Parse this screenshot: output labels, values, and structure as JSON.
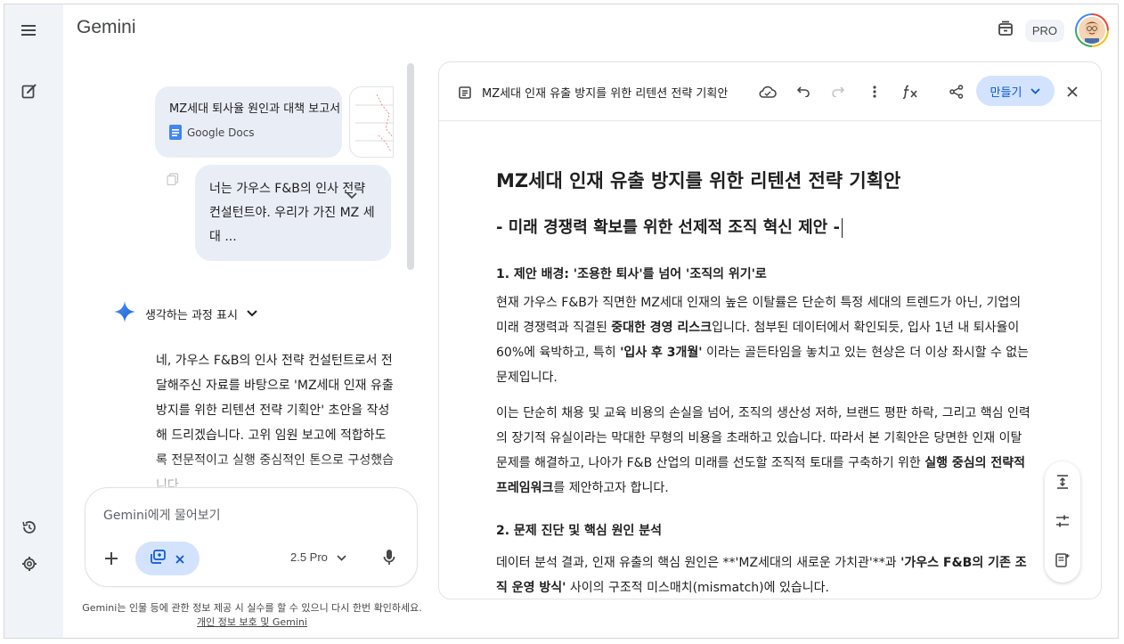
{
  "app": {
    "brand": "Gemini",
    "plan_badge": "PRO"
  },
  "chat": {
    "attachment": {
      "title": "MZ세대 퇴사율 원인과 대책 보고서",
      "source": "Google Docs"
    },
    "user_message": "너는 가우스 F&B의 인사 전략 컨설턴트야. 우리가 가진 MZ 세대 ...",
    "thinking_label": "생각하는 과정 표시",
    "answer": "네, 가우스 F&B의 인사 전략 컨설턴트로서 전달해주신 자료를 바탕으로 'MZ세대 인재 유출 방지를 위한 리텐션 전략 기획안' 초안을 작성해 드리겠습니다. 고위 임원 보고에 적합하도록 전문적이고 실행 중심적인 톤으로 구성했습니다."
  },
  "input": {
    "placeholder": "Gemini에게 물어보기",
    "model": "2.5 Pro"
  },
  "disclaimer": {
    "text": "Gemini는 인물 등에 관한 정보 제공 시 실수를 할 수 있으니 다시 한번 확인하세요.",
    "link": "개인 정보 보호 및 Gemini"
  },
  "doc": {
    "toolbar_title": "MZ세대 인재 유출 방지를 위한 리텐션 전략 기획안",
    "make_label": "만들기",
    "h1": "MZ세대 인재 유출 방지를 위한 리텐션 전략 기획안",
    "h2": "- 미래 경쟁력 확보를 위한 선제적 조직 혁신 제안 -",
    "s1_title": "1. 제안 배경: '조용한 퇴사'를 넘어 '조직의 위기'로",
    "p1": {
      "a": "현재 가우스 F&B가 직면한 MZ세대 인재의 높은 이탈률은 단순히 특정 세대의 트렌드가 아닌, 기업의 미래 경쟁력과 직결된 ",
      "b": "중대한 경영 리스크",
      "c": "입니다. 첨부된 데이터에서 확인되듯, 입사 1년 내 퇴사율이 60%에 육박하고, 특히 ",
      "d": "'입사 후 3개월'",
      "e": " 이라는 골든타임을 놓치고 있는 현상은 더 이상 좌시할 수 없는 문제입니다."
    },
    "p2": {
      "a": "이는 단순히 채용 및 교육 비용의 손실을 넘어, 조직의 생산성 저하, 브랜드 평판 하락, 그리고 핵심 인력의 장기적 유실이라는 막대한 무형의 비용을 초래하고 있습니다. 따라서 본 기획안은 당면한 인재 이탈 문제를 해결하고, 나아가 F&B 산업의 미래를 선도할 조직적 토대를 구축하기 위한 ",
      "b": "실행 중심의 전략적 프레임워크",
      "c": "를 제안하고자 합니다."
    },
    "s2_title": "2. 문제 진단 및 핵심 원인 분석",
    "p3": {
      "a": "데이터 분석 결과, 인재 유출의 핵심 원인은 **'MZ세대의 새로운 가치관'**과 ",
      "b": "'가우스 F&B의 기존 조직 운영 방식'",
      "c": " 사이의 구조적 미스매치(mismatch)에 있습니다."
    }
  },
  "icons": {
    "menu": "menu-icon",
    "new_chat": "edit-icon",
    "history": "history-icon",
    "settings": "gear-icon",
    "gem": "gemini-spark-icon"
  },
  "colors": {
    "rail_bg": "#f0f4f9",
    "accent": "#0b57d0",
    "chip_bg": "#d3e3fd",
    "bubble_bg": "#e9eef6"
  }
}
